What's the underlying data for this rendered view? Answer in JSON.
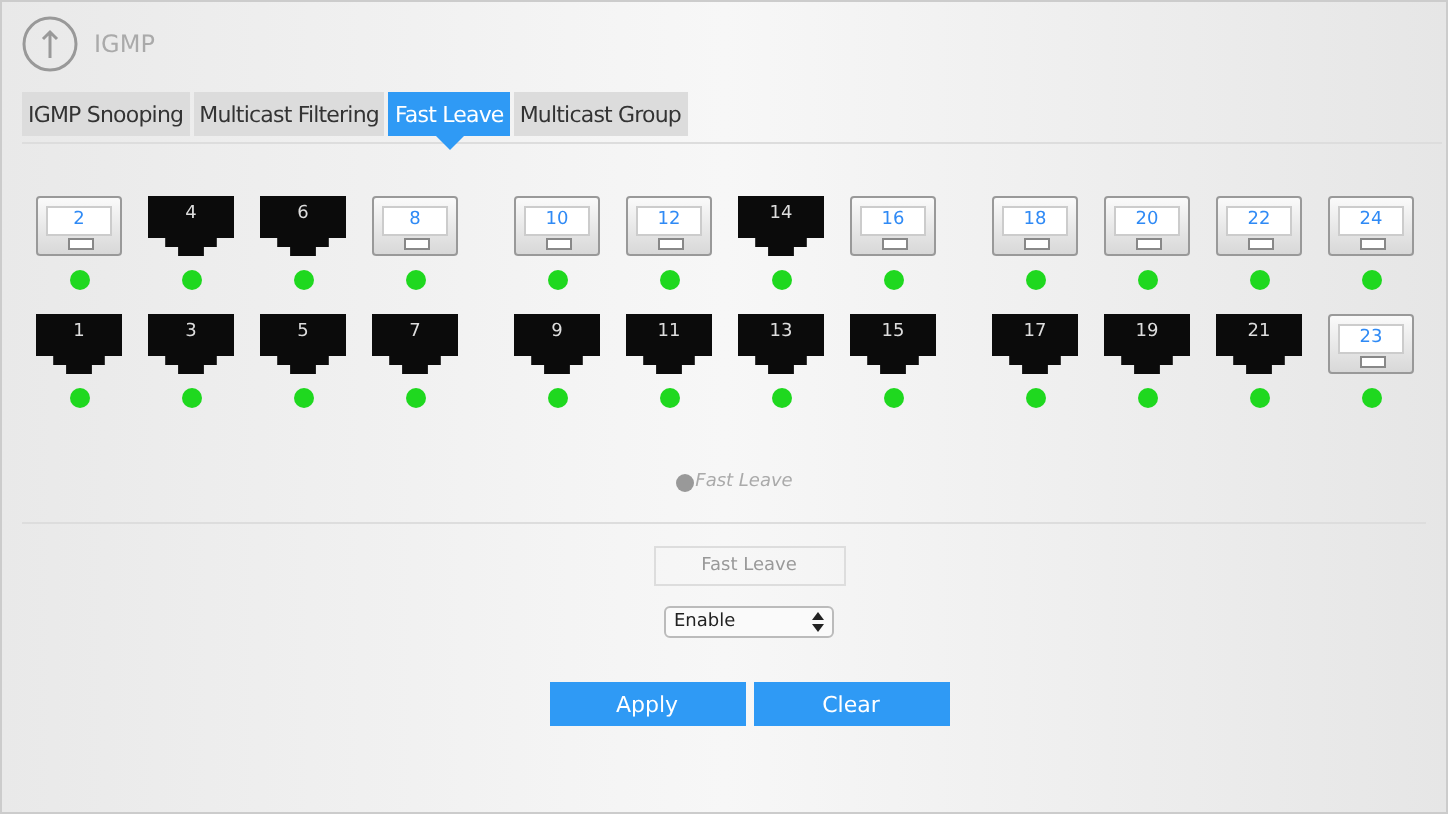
{
  "header": {
    "title": "IGMP"
  },
  "tabs": [
    {
      "label": "IGMP Snooping",
      "selected": false
    },
    {
      "label": "Multicast Filtering",
      "selected": false
    },
    {
      "label": "Fast Leave",
      "selected": true
    },
    {
      "label": "Multicast Group",
      "selected": false
    }
  ],
  "port_rows": [
    [
      {
        "number": "2",
        "selected": true,
        "link_up": true
      },
      {
        "number": "4",
        "selected": false,
        "link_up": true
      },
      {
        "number": "6",
        "selected": false,
        "link_up": true
      },
      {
        "number": "8",
        "selected": true,
        "link_up": true
      },
      {
        "number": "10",
        "selected": true,
        "link_up": true
      },
      {
        "number": "12",
        "selected": true,
        "link_up": true
      },
      {
        "number": "14",
        "selected": false,
        "link_up": true
      },
      {
        "number": "16",
        "selected": true,
        "link_up": true
      },
      {
        "number": "18",
        "selected": true,
        "link_up": true
      },
      {
        "number": "20",
        "selected": true,
        "link_up": true
      },
      {
        "number": "22",
        "selected": true,
        "link_up": true
      },
      {
        "number": "24",
        "selected": true,
        "link_up": true
      }
    ],
    [
      {
        "number": "1",
        "selected": false,
        "link_up": true
      },
      {
        "number": "3",
        "selected": false,
        "link_up": true
      },
      {
        "number": "5",
        "selected": false,
        "link_up": true
      },
      {
        "number": "7",
        "selected": false,
        "link_up": true
      },
      {
        "number": "9",
        "selected": false,
        "link_up": true
      },
      {
        "number": "11",
        "selected": false,
        "link_up": true
      },
      {
        "number": "13",
        "selected": false,
        "link_up": true
      },
      {
        "number": "15",
        "selected": false,
        "link_up": true
      },
      {
        "number": "17",
        "selected": false,
        "link_up": true
      },
      {
        "number": "19",
        "selected": false,
        "link_up": true
      },
      {
        "number": "21",
        "selected": false,
        "link_up": true
      },
      {
        "number": "23",
        "selected": true,
        "link_up": true
      }
    ]
  ],
  "legend": {
    "label": "Fast Leave"
  },
  "form": {
    "field_label": "Fast Leave",
    "select_value": "Enable"
  },
  "buttons": [
    "Apply",
    "Clear"
  ]
}
